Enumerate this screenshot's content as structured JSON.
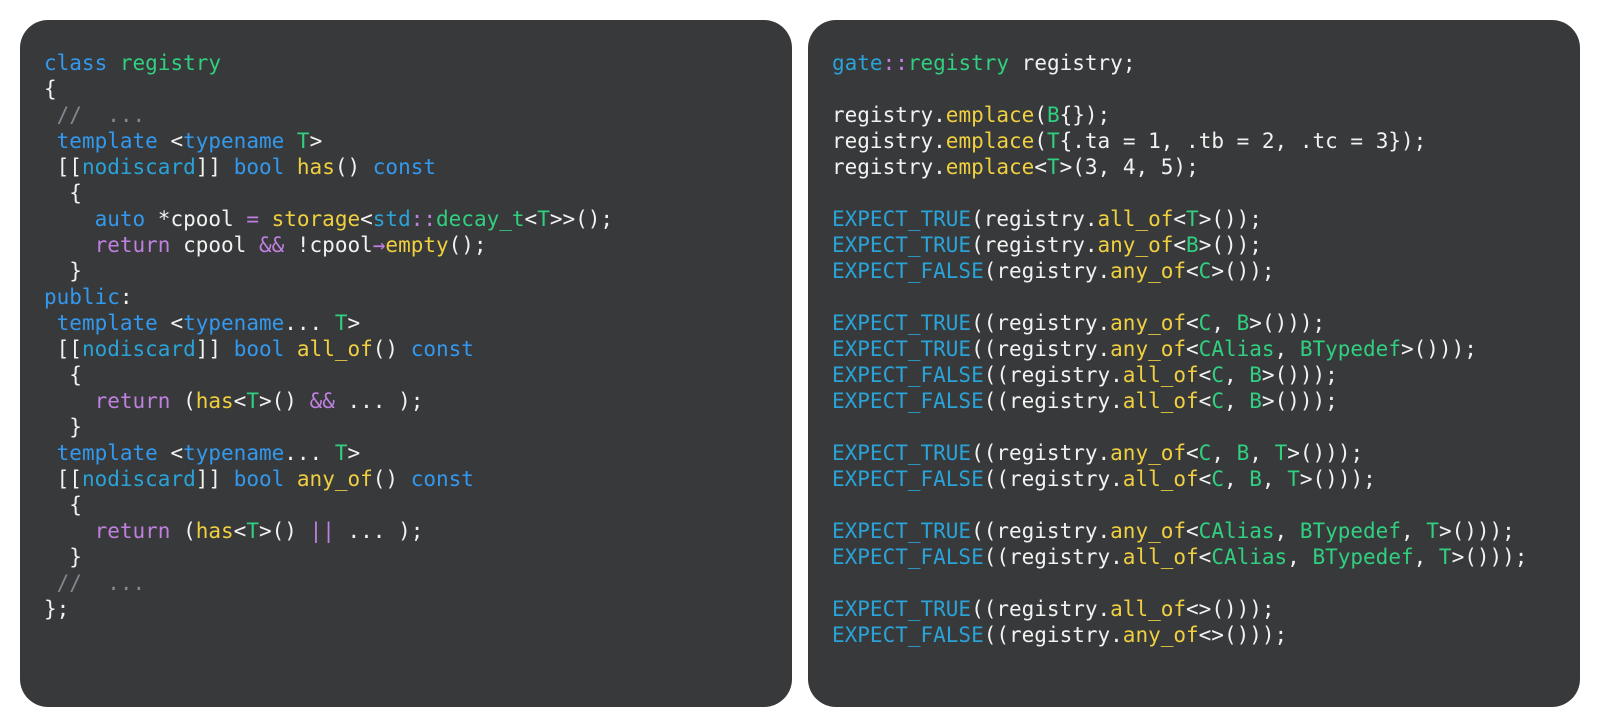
{
  "left": {
    "l01_class": "class",
    "l01_name": "registry",
    "l02_brace": "{",
    "l03_comment": "//  ...",
    "l04_template": "template",
    "l04_open": " <",
    "l04_typename": "typename",
    "l04_T": " T",
    "l04_close": ">",
    "l05_lb1": "[[",
    "l05_nod": "nodiscard",
    "l05_lb2": "]]",
    "l05_bool": " bool",
    "l05_has": " has",
    "l05_parens": "()",
    "l05_const": " const",
    "l06_brace": "  {",
    "l07_auto": "auto",
    "l07_star": " *",
    "l07_cpool": "cpool ",
    "l07_eq": "=",
    "l07_storage": " storage",
    "l07_lt": "<",
    "l07_std": "std",
    "l07_scope": "::",
    "l07_decay": "decay_t",
    "l07_ltT": "<",
    "l07_T": "T",
    "l07_gt2": ">>",
    "l07_call": "();",
    "l08_return": "return",
    "l08_mid": " cpool ",
    "l08_and": "&&",
    "l08_not": " !cpool",
    "l08_arrow": "→",
    "l08_empty": "empty",
    "l08_tail": "();",
    "l09_brace": "  }",
    "l10_public": "public",
    "l10_colon": ":",
    "l11_template": "template",
    "l11_open": " <",
    "l11_typename": "typename",
    "l11_dots": "...",
    "l11_T": " T",
    "l11_close": ">",
    "l12_lb1": "[[",
    "l12_nod": "nodiscard",
    "l12_lb2": "]]",
    "l12_bool": " bool",
    "l12_allof": " all_of",
    "l12_parens": "()",
    "l12_const": " const",
    "l13_brace": "  {",
    "l14_return": "return",
    "l14_open": " (",
    "l14_has": "has",
    "l14_lt": "<",
    "l14_T": "T",
    "l14_gt": ">",
    "l14_call": "() ",
    "l14_and": "&&",
    "l14_dots": " ... ",
    "l14_close": ");",
    "l15_brace": "  }",
    "l16_template": "template",
    "l16_open": " <",
    "l16_typename": "typename",
    "l16_dots": "...",
    "l16_T": " T",
    "l16_close": ">",
    "l17_lb1": "[[",
    "l17_nod": "nodiscard",
    "l17_lb2": "]]",
    "l17_bool": " bool",
    "l17_anyof": " any_of",
    "l17_parens": "()",
    "l17_const": " const",
    "l18_brace": "  {",
    "l19_return": "return",
    "l19_open": " (",
    "l19_has": "has",
    "l19_lt": "<",
    "l19_T": "T",
    "l19_gt": ">",
    "l19_call": "() ",
    "l19_or": "||",
    "l19_dots": " ... ",
    "l19_close": ");",
    "l20_brace": "  }",
    "l21_comment": "//  ...",
    "l22_end": "};"
  },
  "right": {
    "r01_gate": "gate",
    "r01_scope": "::",
    "r01_reg": "registry",
    "r01_var": " registry;",
    "r02": "",
    "r03_pre": "registry.",
    "r03_emp": "emplace",
    "r03_open": "(",
    "r03_B": "B",
    "r03_tail": "{});",
    "r04_pre": "registry.",
    "r04_emp": "emplace",
    "r04_open": "(",
    "r04_T": "T",
    "r04_body": "{.ta = 1, .tb = 2, .tc = 3});",
    "r05_pre": "registry.",
    "r05_emp": "emplace",
    "r05_lt": "<",
    "r05_T": "T",
    "r05_gt": ">",
    "r05_tail": "(3, 4, 5);",
    "r06": "",
    "r07_macro": "EXPECT_TRUE",
    "r07_open": "(registry.",
    "r07_fn": "all_of",
    "r07_lt": "<",
    "r07_T": "T",
    "r07_gt": ">",
    "r07_tail": "());",
    "r08_macro": "EXPECT_TRUE",
    "r08_open": "(registry.",
    "r08_fn": "any_of",
    "r08_lt": "<",
    "r08_B": "B",
    "r08_gt": ">",
    "r08_tail": "());",
    "r09_macro": "EXPECT_FALSE",
    "r09_open": "(registry.",
    "r09_fn": "any_of",
    "r09_lt": "<",
    "r09_C": "C",
    "r09_gt": ">",
    "r09_tail": "());",
    "r10": "",
    "r11_macro": "EXPECT_TRUE",
    "r11_open": "((registry.",
    "r11_fn": "any_of",
    "r11_lt": "<",
    "r11_C": "C",
    "r11_sep": ", ",
    "r11_B": "B",
    "r11_gt": ">",
    "r11_tail": "()));",
    "r12_macro": "EXPECT_TRUE",
    "r12_open": "((registry.",
    "r12_fn": "any_of",
    "r12_lt": "<",
    "r12_CA": "CAlias",
    "r12_sep": ", ",
    "r12_BT": "BTypedef",
    "r12_gt": ">",
    "r12_tail": "()));",
    "r13_macro": "EXPECT_FALSE",
    "r13_open": "((registry.",
    "r13_fn": "all_of",
    "r13_lt": "<",
    "r13_C": "C",
    "r13_sep": ", ",
    "r13_B": "B",
    "r13_gt": ">",
    "r13_tail": "()));",
    "r14_macro": "EXPECT_FALSE",
    "r14_open": "((registry.",
    "r14_fn": "all_of",
    "r14_lt": "<",
    "r14_C": "C",
    "r14_sep": ", ",
    "r14_B": "B",
    "r14_gt": ">",
    "r14_tail": "()));",
    "r15": "",
    "r16_macro": "EXPECT_TRUE",
    "r16_open": "((registry.",
    "r16_fn": "any_of",
    "r16_lt": "<",
    "r16_C": "C",
    "r16_s1": ", ",
    "r16_B": "B",
    "r16_s2": ", ",
    "r16_T": "T",
    "r16_gt": ">",
    "r16_tail": "()));",
    "r17_macro": "EXPECT_FALSE",
    "r17_open": "((registry.",
    "r17_fn": "all_of",
    "r17_lt": "<",
    "r17_C": "C",
    "r17_s1": ", ",
    "r17_B": "B",
    "r17_s2": ", ",
    "r17_T": "T",
    "r17_gt": ">",
    "r17_tail": "()));",
    "r18": "",
    "r19_macro": "EXPECT_TRUE",
    "r19_open": "((registry.",
    "r19_fn": "any_of",
    "r19_lt": "<",
    "r19_CA": "CAlias",
    "r19_s1": ", ",
    "r19_BT": "BTypedef",
    "r19_s2": ", ",
    "r19_T": "T",
    "r19_gt": ">",
    "r19_tail": "()));",
    "r20_macro": "EXPECT_FALSE",
    "r20_open": "((registry.",
    "r20_fn": "all_of",
    "r20_lt": "<",
    "r20_CA": "CAlias",
    "r20_s1": ", ",
    "r20_BT": "BTypedef",
    "r20_s2": ", ",
    "r20_T": "T",
    "r20_gt": ">",
    "r20_tail": "()));",
    "r21": "",
    "r22_macro": "EXPECT_TRUE",
    "r22_open": "((registry.",
    "r22_fn": "all_of",
    "r22_ang": "<>",
    "r22_tail": "()));",
    "r23_macro": "EXPECT_FALSE",
    "r23_open": "((registry.",
    "r23_fn": "any_of",
    "r23_ang": "<>",
    "r23_tail": "()));"
  }
}
